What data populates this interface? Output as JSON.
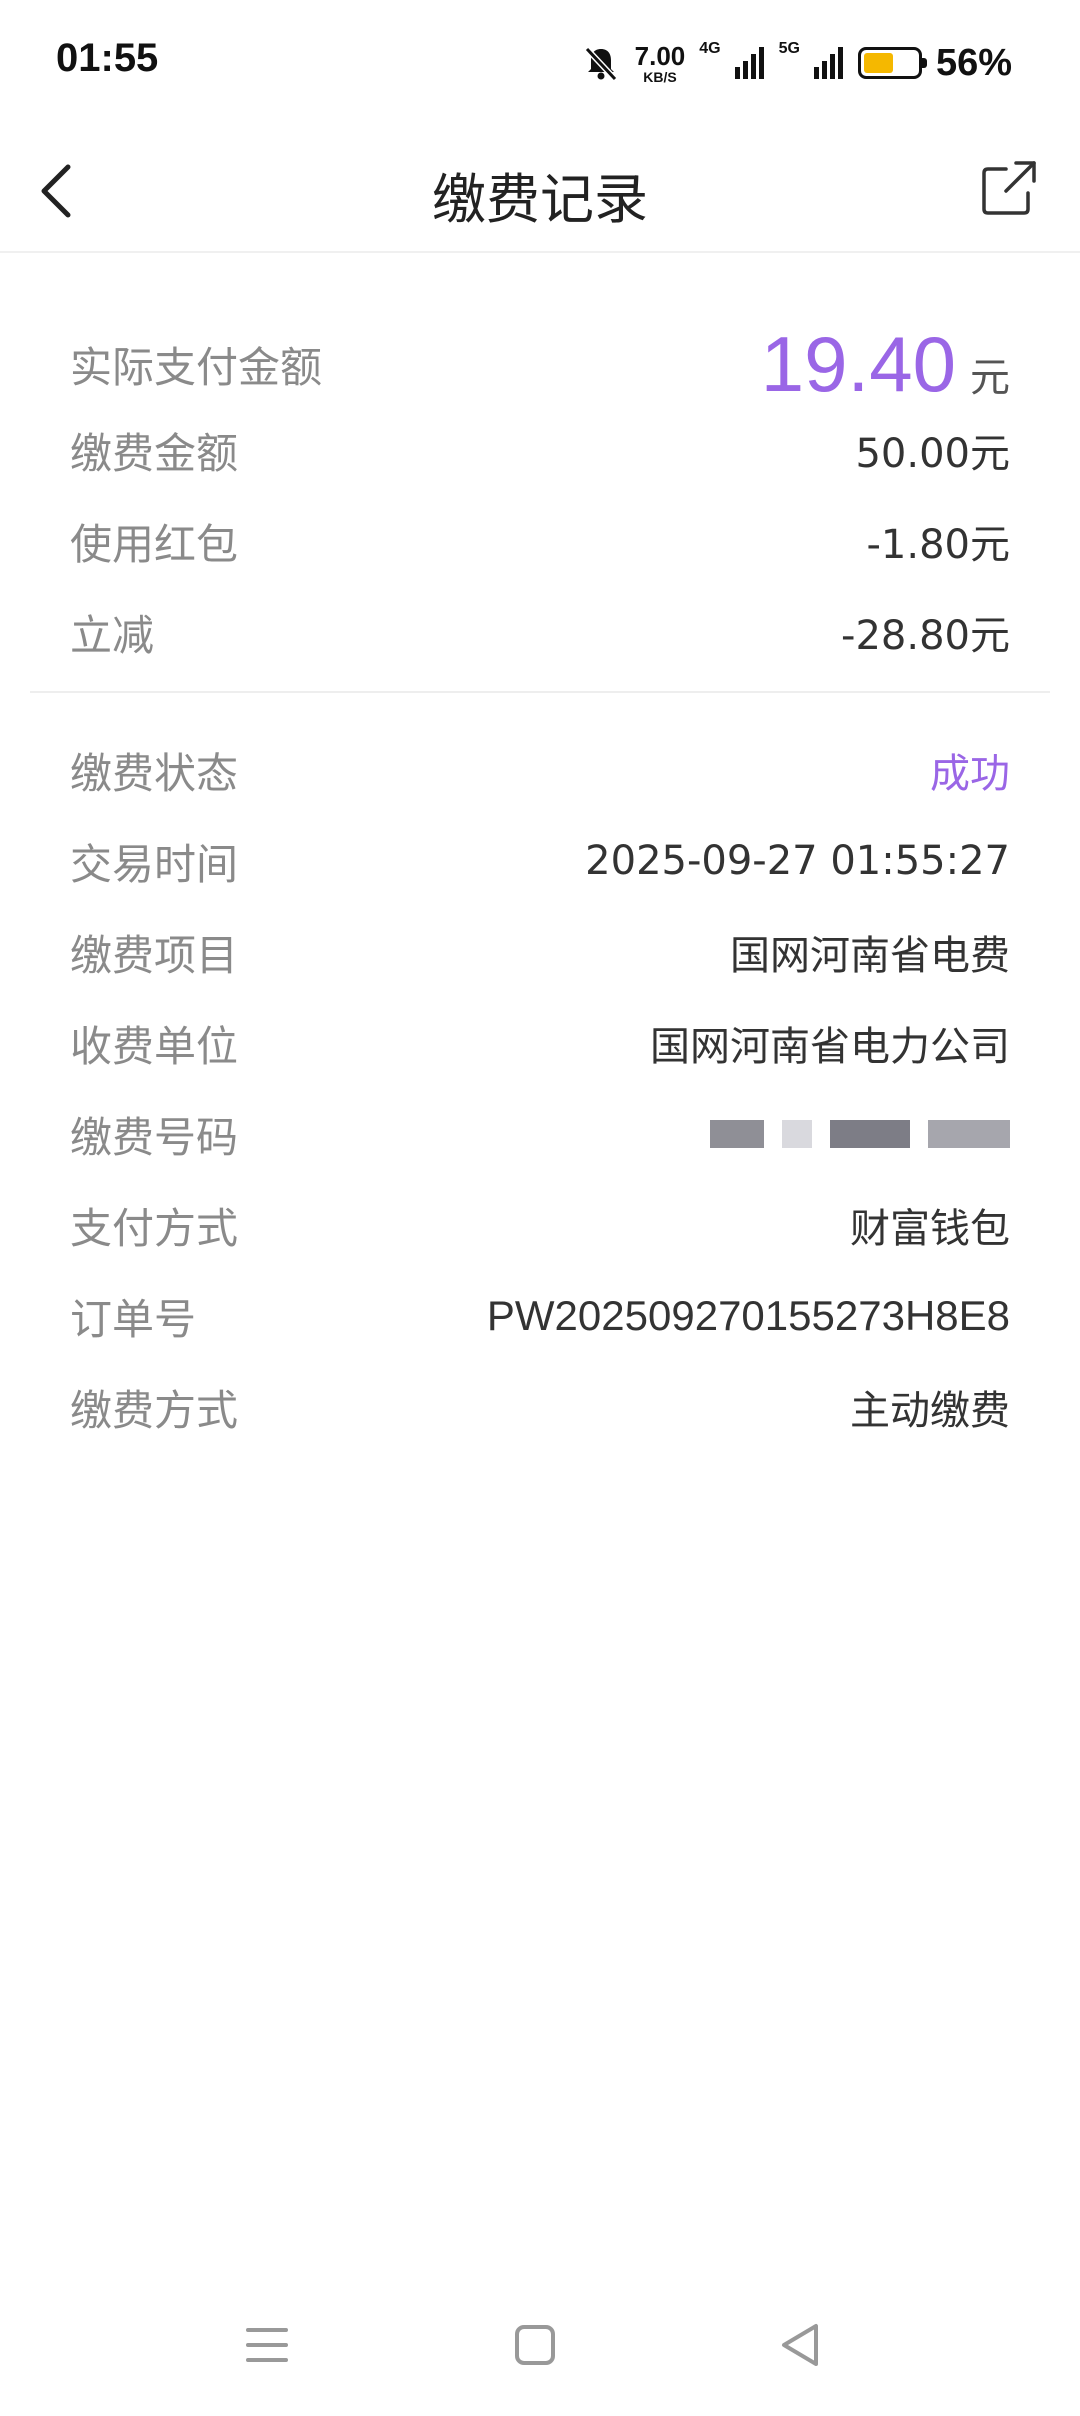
{
  "status_bar": {
    "time": "01:55",
    "speed_value": "7.00",
    "speed_unit": "KB/S",
    "net_4g": "4G",
    "net_5g": "5G",
    "battery": "56%",
    "battery_level": 0.56,
    "battery_color": "#f5b800"
  },
  "header": {
    "title": "缴费记录",
    "back_icon": "chevron-left-icon",
    "share_icon": "share-icon"
  },
  "summary": {
    "actual_paid_label": "实际支付金额",
    "actual_paid_value": "19.40",
    "actual_paid_unit": "元",
    "items": [
      {
        "label": "缴费金额",
        "value": "50.00元"
      },
      {
        "label": "使用红包",
        "value": "-1.80元"
      },
      {
        "label": "立减",
        "value": "-28.80元"
      }
    ]
  },
  "details": {
    "status_label": "缴费状态",
    "status_value": "成功",
    "time_label": "交易时间",
    "time_value": "2025-09-27 01:55:27",
    "item_label": "缴费项目",
    "item_value": "国网河南省电费",
    "unit_label": "收费单位",
    "unit_value": "国网河南省电力公司",
    "number_label": "缴费号码",
    "method_label": "支付方式",
    "method_value": "财富钱包",
    "order_label": "订单号",
    "order_value": "PW202509270155273H8E8",
    "type_label": "缴费方式",
    "type_value": "主动缴费"
  },
  "colors": {
    "accent": "#9a66e6",
    "label": "#8a8a8a",
    "value": "#333333"
  }
}
